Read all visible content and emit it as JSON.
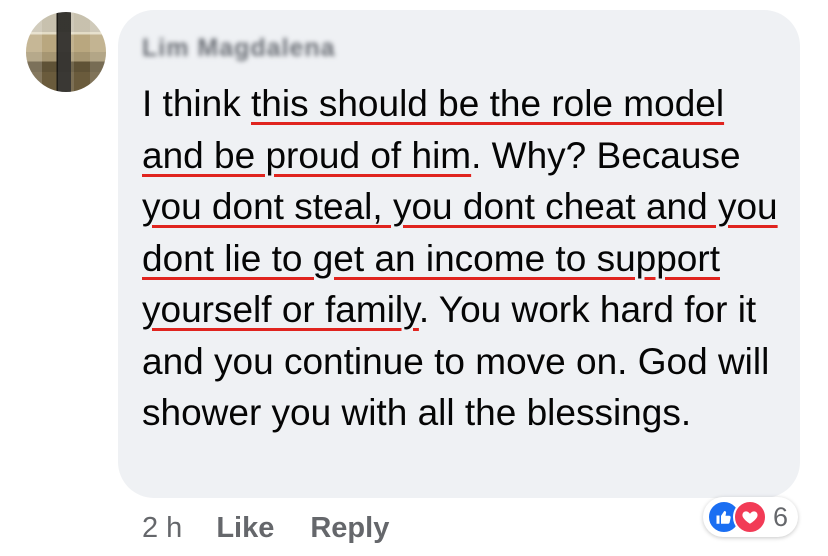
{
  "comment": {
    "author": "Lim Magdalena",
    "segments": [
      {
        "text": "I think ",
        "underline": false
      },
      {
        "text": "this should be the role model and be proud of him",
        "underline": true
      },
      {
        "text": ". Why? Because ",
        "underline": false
      },
      {
        "text": "you dont steal, you dont cheat and you dont lie to get an income to support yourself or family",
        "underline": true
      },
      {
        "text": ". You work hard for it and you continue to move on. God will shower you with all the blessings.",
        "underline": false
      }
    ],
    "timestamp": "2 h",
    "like_label": "Like",
    "reply_label": "Reply",
    "reaction_count": "6",
    "reactions": [
      "like-icon",
      "love-icon"
    ]
  },
  "colors": {
    "bubble": "#eff1f4",
    "underline": "#e0241f",
    "like": "#1a6ef2",
    "love": "#f23b56"
  }
}
